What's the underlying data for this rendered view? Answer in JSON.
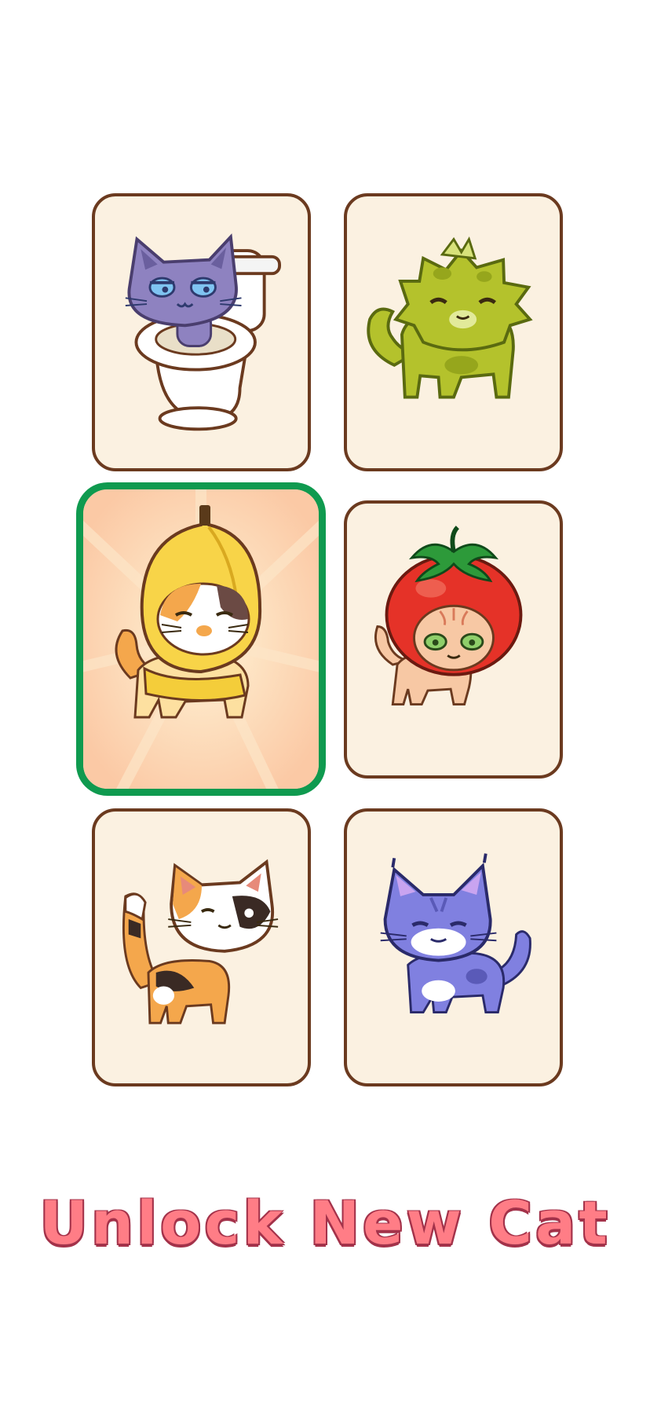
{
  "cat_cards": [
    {
      "id": "toilet-cat",
      "icon": "skibidi-toilet-cat-icon",
      "selected": false
    },
    {
      "id": "green-fluffy-cat",
      "icon": "green-fluffy-cat-icon",
      "selected": false
    },
    {
      "id": "banana-cat",
      "icon": "banana-cat-icon",
      "selected": true
    },
    {
      "id": "tomato-cat",
      "icon": "tomato-cat-icon",
      "selected": false
    },
    {
      "id": "calico-cat",
      "icon": "calico-cat-icon",
      "selected": false
    },
    {
      "id": "purple-lynx-cat",
      "icon": "purple-lynx-cat-icon",
      "selected": false
    }
  ],
  "colors": {
    "card_bg": "#fbf1e1",
    "card_border": "#6b3a1f",
    "selected_border": "#0f9a4f",
    "title_fill": "#ff7d86",
    "title_outline": "#a3324a"
  },
  "unlock_label": "Unlock New Cat"
}
